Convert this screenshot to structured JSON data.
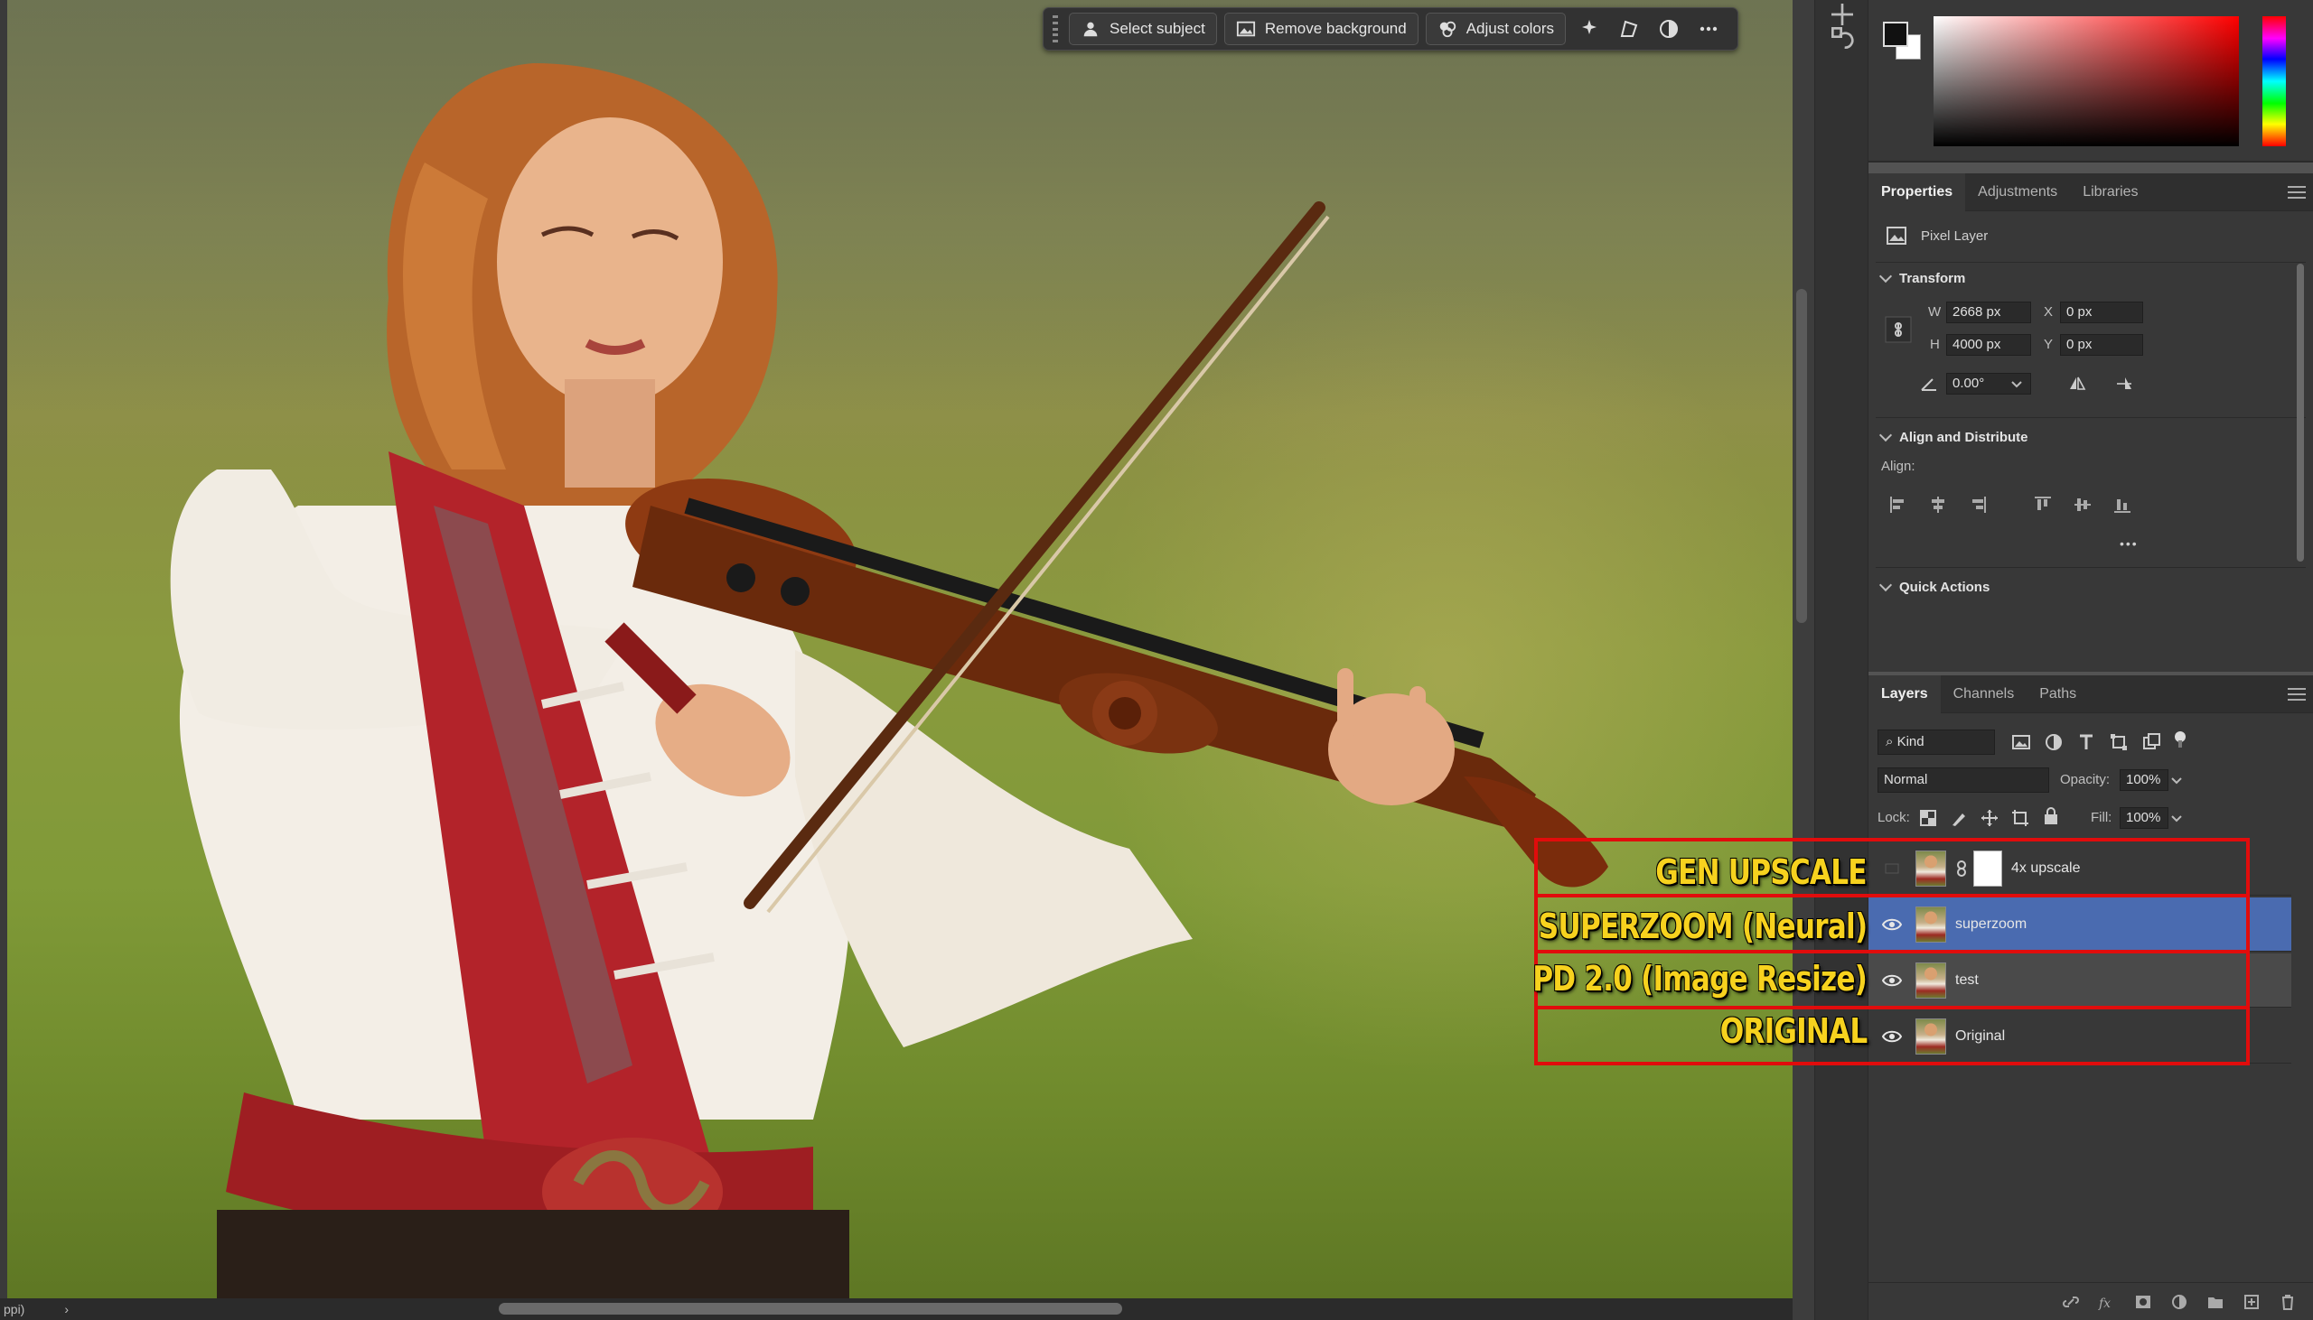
{
  "taskbar": {
    "select_subject": "Select subject",
    "remove_background": "Remove background",
    "adjust_colors": "Adjust colors"
  },
  "status": {
    "zoom_text": "ppi)",
    "arrow": "›"
  },
  "properties": {
    "tabs": [
      "Properties",
      "Adjustments",
      "Libraries"
    ],
    "layer_kind": "Pixel Layer",
    "transform": {
      "title": "Transform",
      "w_label": "W",
      "w_value": "2668 px",
      "h_label": "H",
      "h_value": "4000 px",
      "x_label": "X",
      "x_value": "0 px",
      "y_label": "Y",
      "y_value": "0 px",
      "angle_value": "0.00°"
    },
    "align": {
      "title": "Align and Distribute",
      "label": "Align:",
      "more": "•••"
    },
    "quick_actions": "Quick Actions"
  },
  "layers_panel": {
    "tabs": [
      "Layers",
      "Channels",
      "Paths"
    ],
    "filter_kind": "Kind",
    "blend_mode": "Normal",
    "opacity_label": "Opacity:",
    "opacity_value": "100%",
    "lock_label": "Lock:",
    "fill_label": "Fill:",
    "fill_value": "100%",
    "layers": [
      {
        "name": "4x upscale",
        "visible": false,
        "has_mask": true,
        "state": "normal"
      },
      {
        "name": "superzoom",
        "visible": true,
        "has_mask": false,
        "state": "selected"
      },
      {
        "name": "test",
        "visible": true,
        "has_mask": false,
        "state": "hover"
      },
      {
        "name": "Original",
        "visible": true,
        "has_mask": false,
        "state": "normal"
      }
    ]
  },
  "annotations": {
    "gen_upscale": "GEN UPSCALE",
    "superzoom": "SUPERZOOM (Neural)",
    "pd": "PD 2.0 (Image Resize)",
    "original": "ORIGINAL",
    "color": "#f7d21e",
    "box_color": "#e10c0c"
  },
  "colors": {
    "selected_layer": "#4a6bb0",
    "panel_bg": "#383838"
  }
}
